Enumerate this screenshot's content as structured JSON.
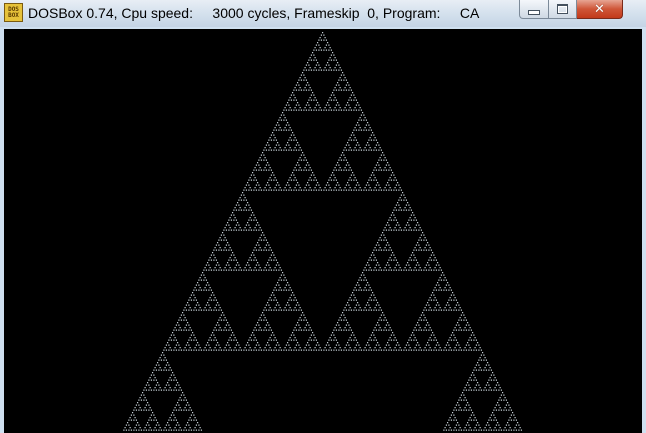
{
  "window": {
    "title": "DOSBox 0.74, Cpu speed:     3000 cycles, Frameskip  0, Program:     CA",
    "icon": "dosbox-icon",
    "icon_text_top": "DOS",
    "icon_text_bottom": "BOX"
  },
  "controls": {
    "minimize_icon": "minimize-icon",
    "maximize_icon": "maximize-icon",
    "close_icon": "close-icon",
    "close_glyph": "✕"
  },
  "screen": {
    "background_color": "#000000",
    "pattern_color": "#c8d2d8",
    "pattern": "sierpinski-triangle"
  }
}
